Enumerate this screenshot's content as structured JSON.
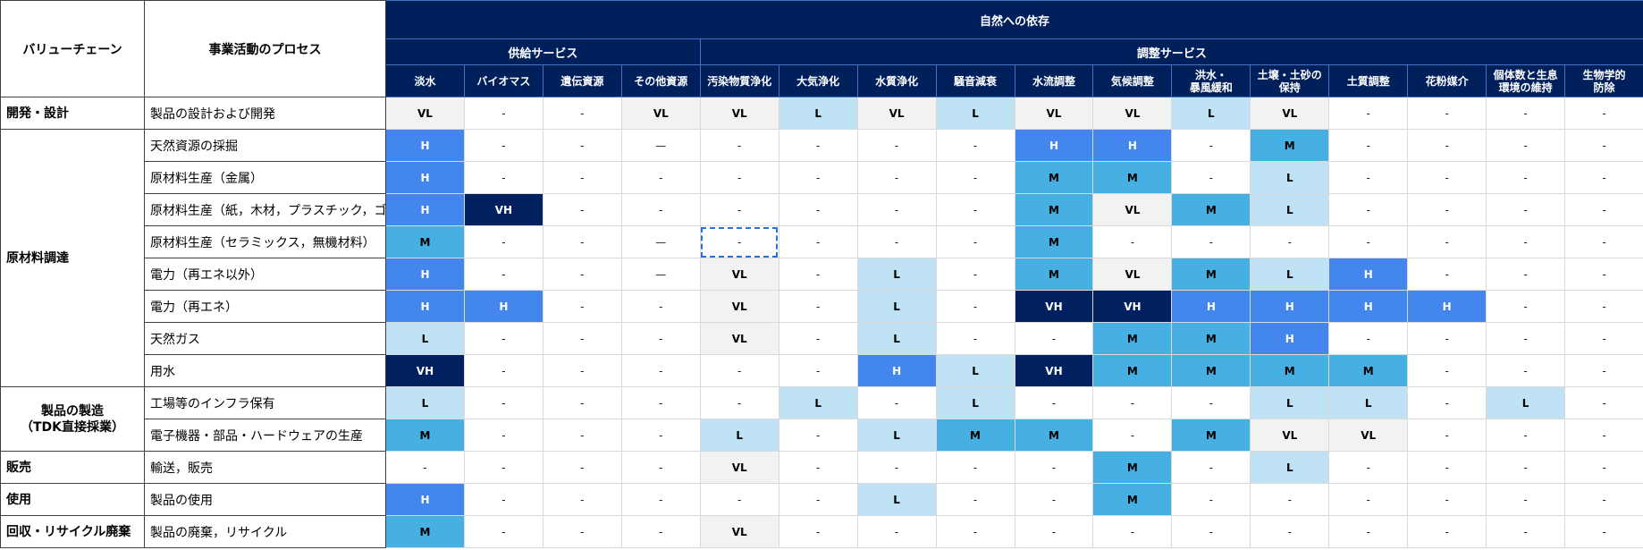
{
  "header": {
    "value_chain": "バリューチェーン",
    "process": "事業活動のプロセス",
    "top": "自然への依存",
    "groups": [
      {
        "label": "供給サービス",
        "span": 4
      },
      {
        "label": "調整サービス",
        "span": 12
      }
    ],
    "columns": [
      "淡水",
      "バイオマス",
      "遺伝資源",
      "その他資源",
      "汚染物質浄化",
      "大気浄化",
      "水質浄化",
      "騒音減衰",
      "水流調整",
      "気候調整",
      "洪水・\n暴風緩和",
      "土壌・土砂の\n保持",
      "土質調整",
      "花粉媒介",
      "個体数と生息\n環境の維持",
      "生物学的\n防除"
    ]
  },
  "groups": [
    {
      "label": "開発・設計",
      "center": false,
      "rows": [
        {
          "process": "製品の設計および開発",
          "cells": [
            "VL",
            "-",
            "-",
            "VL",
            "VL",
            "L",
            "VL",
            "L",
            "VL",
            "VL",
            "L",
            "VL",
            "-",
            "-",
            "-",
            "-"
          ]
        }
      ]
    },
    {
      "label": "原材料調達",
      "center": false,
      "rows": [
        {
          "process": "天然資源の採掘",
          "cells": [
            "H",
            "-",
            "-",
            "—",
            "-",
            "-",
            "-",
            "-",
            "H",
            "H",
            "-",
            "M",
            "-",
            "-",
            "-",
            "-"
          ]
        },
        {
          "process": "原材料生産（金属）",
          "cells": [
            "H",
            "-",
            "-",
            "-",
            "-",
            "-",
            "-",
            "-",
            "M",
            "M",
            "-",
            "L",
            "-",
            "-",
            "-",
            "-"
          ]
        },
        {
          "process": "原材料生産（紙，木材，プラスチック，ゴム）",
          "cells": [
            "H",
            "VH",
            "-",
            "-",
            "-",
            "-",
            "-",
            "-",
            "M",
            "VL",
            "M",
            "L",
            "-",
            "-",
            "-",
            "-"
          ]
        },
        {
          "process": "原材料生産（セラミックス，無機材料）",
          "cells": [
            "M",
            "-",
            "-",
            "—",
            "-",
            "-",
            "-",
            "-",
            "M",
            "-",
            "-",
            "-",
            "-",
            "-",
            "-",
            "-"
          ]
        },
        {
          "process": "電力（再エネ以外）",
          "cells": [
            "H",
            "-",
            "-",
            "—",
            "VL",
            "-",
            "L",
            "-",
            "M",
            "VL",
            "M",
            "L",
            "H",
            "-",
            "-",
            "-"
          ]
        },
        {
          "process": "電力（再エネ）",
          "cells": [
            "H",
            "H",
            "-",
            "-",
            "VL",
            "-",
            "L",
            "-",
            "VH",
            "VH",
            "H",
            "H",
            "H",
            "H",
            "-",
            "-"
          ]
        },
        {
          "process": "天然ガス",
          "cells": [
            "L",
            "-",
            "-",
            "-",
            "VL",
            "-",
            "L",
            "-",
            "-",
            "M",
            "M",
            "H",
            "-",
            "-",
            "-",
            "-"
          ]
        },
        {
          "process": "用水",
          "cells": [
            "VH",
            "-",
            "-",
            "-",
            "-",
            "-",
            "H",
            "L",
            "VH",
            "M",
            "M",
            "M",
            "M",
            "-",
            "-",
            "-"
          ]
        }
      ]
    },
    {
      "label": "製品の製造\n（TDK直接採業）",
      "center": true,
      "rows": [
        {
          "process": "工場等のインフラ保有",
          "cells": [
            "L",
            "-",
            "-",
            "-",
            "-",
            "L",
            "-",
            "L",
            "-",
            "-",
            "-",
            "L",
            "L",
            "-",
            "L",
            "-"
          ]
        },
        {
          "process": "電子機器・部品・ハードウェアの生産",
          "cells": [
            "M",
            "-",
            "-",
            "-",
            "L",
            "-",
            "L",
            "M",
            "M",
            "-",
            "M",
            "VL",
            "VL",
            "-",
            "-",
            "-"
          ]
        }
      ]
    },
    {
      "label": "販売",
      "center": false,
      "rows": [
        {
          "process": "輸送，販売",
          "cells": [
            "-",
            "-",
            "-",
            "-",
            "VL",
            "-",
            "-",
            "-",
            "-",
            "M",
            "-",
            "L",
            "-",
            "-",
            "-",
            "-"
          ]
        }
      ]
    },
    {
      "label": "使用",
      "center": false,
      "rows": [
        {
          "process": "製品の使用",
          "cells": [
            "H",
            "-",
            "-",
            "-",
            "-",
            "-",
            "L",
            "-",
            "-",
            "M",
            "-",
            "-",
            "-",
            "-",
            "-",
            "-"
          ]
        }
      ]
    },
    {
      "label": "回収・リサイクル廃棄",
      "center": false,
      "rows": [
        {
          "process": "製品の廃棄，リサイクル",
          "cells": [
            "M",
            "-",
            "-",
            "-",
            "VL",
            "-",
            "-",
            "-",
            "-",
            "-",
            "-",
            "-",
            "-",
            "-",
            "-",
            "-"
          ]
        }
      ]
    }
  ],
  "selected_cell": {
    "row_process": "原材料生産（セラミックス，無機材料）",
    "col": 4
  },
  "level_colors": {
    "VL": "#f2f2f2",
    "L": "#bfe3f4",
    "M": "#46b0e3",
    "H": "#4286ee",
    "VH": "#002060",
    "header_bg": "#00205b"
  }
}
